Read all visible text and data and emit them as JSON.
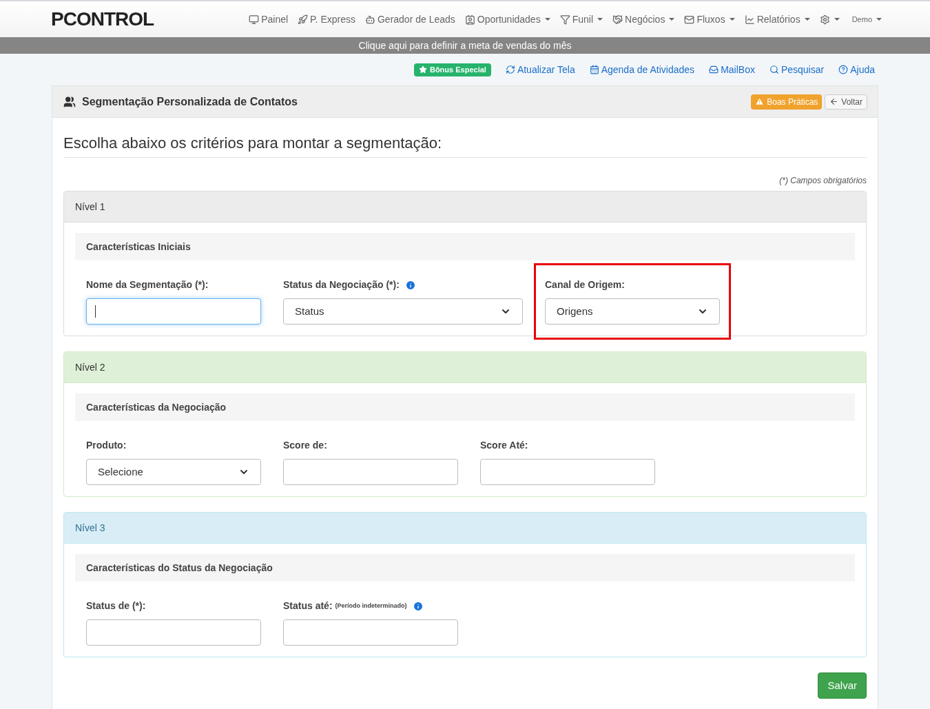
{
  "brand": {
    "logo": "PCONTROL"
  },
  "nav": [
    {
      "label": "Painel",
      "dropdown": false
    },
    {
      "label": "P. Express",
      "dropdown": false
    },
    {
      "label": "Gerador de Leads",
      "dropdown": false
    },
    {
      "label": "Oportunidades",
      "dropdown": true
    },
    {
      "label": "Funil",
      "dropdown": true
    },
    {
      "label": "Negócios",
      "dropdown": true
    },
    {
      "label": "Fluxos",
      "dropdown": true
    },
    {
      "label": "Relatórios",
      "dropdown": true
    },
    {
      "dropdown": true
    }
  ],
  "user_menu": {
    "label": "Demo"
  },
  "banner": "Clique aqui para definir a meta de vendas do mês",
  "quick_links": [
    {
      "label": "Bônus Especial",
      "kind": "badge"
    },
    {
      "label": "Atualizar Tela",
      "kind": "link"
    },
    {
      "label": "Agenda de Atividades",
      "kind": "link"
    },
    {
      "label": "MailBox",
      "kind": "link"
    },
    {
      "label": "Pesquisar",
      "kind": "link"
    },
    {
      "label": "Ajuda",
      "kind": "link"
    }
  ],
  "panel": {
    "title": "Segmentação Personalizada de Contatos",
    "buttons": [
      {
        "label": "Boas Práticas",
        "kind": "warning"
      },
      {
        "label": "Voltar",
        "kind": "default"
      }
    ]
  },
  "heading": "Escolha abaixo os critérios para montar a segmentação:",
  "required_note": "(*) Campos obrigatórios",
  "levels": [
    {
      "title": "Nível 1",
      "kind": "default",
      "section": "Características Iniciais",
      "fields": [
        {
          "label": "Nome da Segmentação (*):",
          "kind": "input",
          "focused": true,
          "info": false,
          "highlighted": false
        },
        {
          "label": "Status da Negociação (*):",
          "kind": "select",
          "value": "Status",
          "focused": false,
          "info": true,
          "highlighted": false
        },
        {
          "label": "Canal de Origem:",
          "kind": "select",
          "value": "Origens",
          "focused": false,
          "info": false,
          "highlighted": true
        }
      ]
    },
    {
      "title": "Nível 2",
      "kind": "success",
      "section": "Características da Negociação",
      "fields": [
        {
          "label": "Produto:",
          "kind": "select",
          "value": "Selecione",
          "focused": false,
          "info": false,
          "highlighted": false
        },
        {
          "label": "Score de:",
          "kind": "input",
          "focused": false,
          "info": false,
          "highlighted": false
        },
        {
          "label": "Score Até:",
          "kind": "input",
          "focused": false,
          "info": false,
          "highlighted": false
        }
      ]
    },
    {
      "title": "Nível 3",
      "kind": "info",
      "section": "Características do Status da Negociação",
      "fields": [
        {
          "label": "Status de (*):",
          "kind": "input",
          "focused": false,
          "info": false,
          "highlighted": false
        },
        {
          "label": "Status até:",
          "note": "(Período indeterminado)",
          "kind": "input",
          "focused": false,
          "info": true,
          "highlighted": false
        }
      ]
    }
  ],
  "save_button": "Salvar"
}
